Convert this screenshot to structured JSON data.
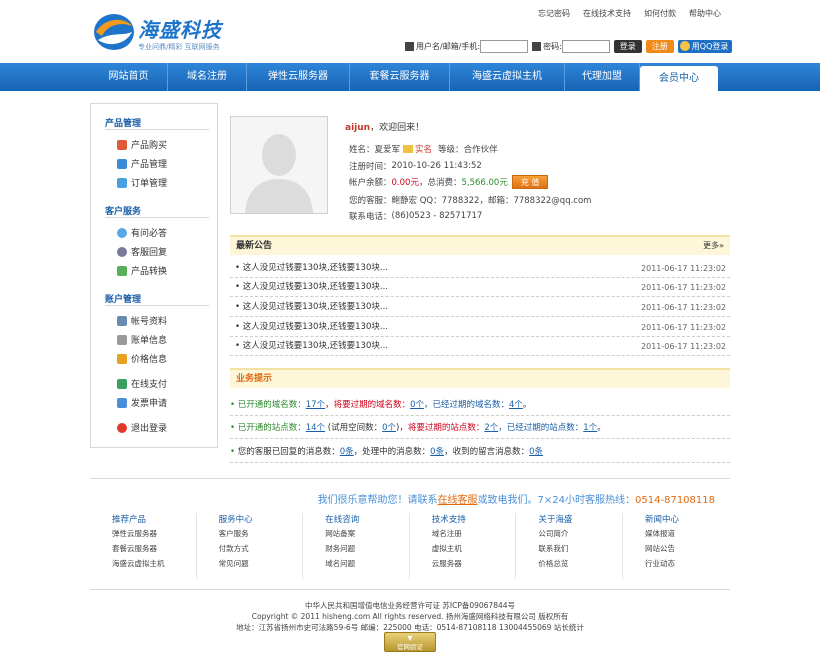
{
  "brand": {
    "name": "海盛科技",
    "slogan": "专业问鼎/精彩 互联网服务",
    "accent": "#1d74c8"
  },
  "toplinks": [
    "忘记密码",
    "在线技术支持",
    "如何付款",
    "帮助中心"
  ],
  "login": {
    "user_label": "用户名/邮箱/手机:",
    "user_value": "",
    "pwd_label": "密码:",
    "pwd_value": "",
    "login_btn": "登录",
    "register_btn": "注册",
    "qq_btn": "用QQ登录"
  },
  "nav": {
    "items": [
      "网站首页",
      "域名注册",
      "弹性云服务器",
      "套餐云服务器",
      "海盛云虚拟主机",
      "代理加盟",
      "会员中心"
    ],
    "active": "会员中心"
  },
  "sidebar": {
    "groups": [
      {
        "title": "产品管理",
        "items": [
          "产品购买",
          "产品管理",
          "订单管理"
        ]
      },
      {
        "title": "客户服务",
        "items": [
          "有问必答",
          "客服回复",
          "产品转换"
        ]
      },
      {
        "title": "账户管理",
        "items": [
          "帐号资料",
          "账单信息",
          "价格信息",
          "在线支付",
          "发票申请",
          "退出登录"
        ]
      }
    ]
  },
  "profile": {
    "username": "aijun",
    "welcome": "，欢迎回来！",
    "name_label": "姓名：",
    "name_value": "夏爱军",
    "realname_badge": "实名",
    "level_label": "等级：",
    "level_value": "合作伙伴",
    "reg_time_label": "注册时间：",
    "reg_time_value": "2010-10-26 11:43:52",
    "balance_label": "帐户余额：",
    "balance_value": "0.00元",
    "total_label": "，总消费：",
    "total_value": "5,566.00元",
    "charge_btn": "充 值",
    "support_label": "您的客服：",
    "support_value": "鲍静宏 QQ：7788322，邮箱：7788322@qq.com",
    "phone_label": "联系电话：",
    "phone_value": "(86)0523 - 82571717"
  },
  "notices": {
    "title": "最新公告",
    "more": "更多»",
    "items": [
      {
        "title": "这人没见过钱要130块,还钱要130块...",
        "date": "2011-06-17 11:23:02"
      },
      {
        "title": "这人没见过钱要130块,还钱要130块...",
        "date": "2011-06-17 11:23:02"
      },
      {
        "title": "这人没见过钱要130块,还钱要130块...",
        "date": "2011-06-17 11:23:02"
      },
      {
        "title": "这人没见过钱要130块,还钱要130块...",
        "date": "2011-06-17 11:23:02"
      },
      {
        "title": "这人没见过钱要130块,还钱要130块...",
        "date": "2011-06-17 11:23:02"
      }
    ]
  },
  "tips": {
    "title": "业务提示",
    "domain": {
      "open_label": "已开通的域名数：",
      "open_value": "17个",
      "expiring_label": "，将要过期的域名数：",
      "expiring_value": "0个",
      "expired_label": "，已经过期的域名数：",
      "expired_value": "4个",
      "end": "。"
    },
    "site": {
      "open_label": "已开通的站点数：",
      "open_value": "14个",
      "trial_label": " (试用空间数：",
      "trial_value": "0个",
      "trial_end": ")",
      "expiring_label": "，将要过期的站点数：",
      "expiring_value": "2个",
      "expired_label": "，已经过期的站点数：",
      "expired_value": "1个",
      "end": "。"
    },
    "messages": {
      "replied_label": "您的客服已回复的消息数：",
      "replied_value": "0条",
      "processing_label": "，处理中的消息数：",
      "processing_value": "0条",
      "received_label": "，收到的留言消息数：",
      "received_value": "0条"
    }
  },
  "hotline": {
    "pre": "我们很乐意帮助您！请联系",
    "link": "在线客服",
    "mid": "或致电我们。7×24小时客服热线：",
    "phone": "0514-87108118"
  },
  "footer_cols": [
    {
      "title": "推荐产品",
      "links": [
        "弹性云服务器",
        "套餐云服务器",
        "海盛云虚拟主机"
      ]
    },
    {
      "title": "服务中心",
      "links": [
        "客户服务",
        "付款方式",
        "常见问题"
      ]
    },
    {
      "title": "在线咨询",
      "links": [
        "网站备案",
        "财务问题",
        "域名问题"
      ]
    },
    {
      "title": "技术支持",
      "links": [
        "域名注册",
        "虚拟主机",
        "云服务器"
      ]
    },
    {
      "title": "关于海盛",
      "links": [
        "公司简介",
        "联系我们",
        "价格总览"
      ]
    },
    {
      "title": "新闻中心",
      "links": [
        "媒体报道",
        "网站公告",
        "行业动态"
      ]
    }
  ],
  "copyright": {
    "line1": "中华人民共和国增值电信业务经营许可证 苏ICP备09067844号",
    "line2": "Copyright © 2011 hisheng.com All rights reserved. 扬州海盛网络科技有限公司 版权所有",
    "line3": "地址：江苏省扬州市史可法路59-6号 邮编：225000 电话：0514-87108118  13004455069 站长统计",
    "badge": "官网验证"
  }
}
